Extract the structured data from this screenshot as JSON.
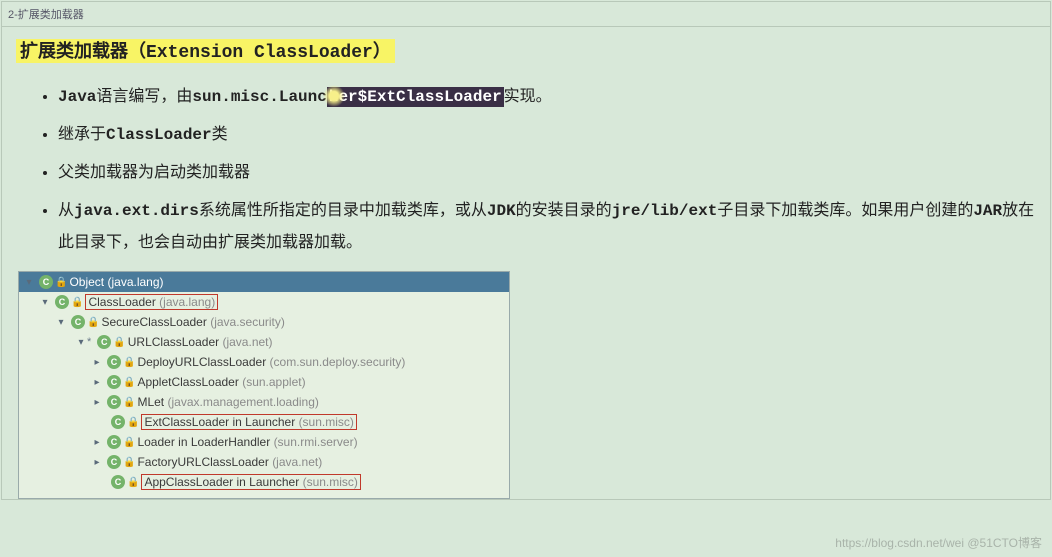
{
  "tab": {
    "title": "2-扩展类加载器"
  },
  "heading": {
    "prefix": "扩展类加载器（",
    "en": "Extension ClassLoader",
    "suffix": "）"
  },
  "bullets": {
    "b1_a": "Java",
    "b1_b": "语言编写，由",
    "b1_c": "sun.misc.Launc",
    "b1_sel": "her$ExtClassLoader",
    "b1_d": "实现。",
    "b2_a": "继承于",
    "b2_b": "ClassLoader",
    "b2_c": "类",
    "b3": "父类加载器为启动类加载器",
    "b4_a": "从",
    "b4_b": "java.ext.dirs",
    "b4_c": "系统属性所指定的目录中加载类库，或从",
    "b4_d": "JDK",
    "b4_e": "的安装目录的",
    "b4_f": "jre/lib/ext",
    "b4_g": "子目录下加载类库。如果用户创建的",
    "b4_h": "JAR",
    "b4_i": "放在此目录下，也会自动由扩展类加载器加载。"
  },
  "tree": {
    "root_name": "Object",
    "root_pkg": "(java.lang)",
    "n1_name": "ClassLoader",
    "n1_pkg": "(java.lang)",
    "n2_name": "SecureClassLoader",
    "n2_pkg": "(java.security)",
    "n3_name": "URLClassLoader",
    "n3_pkg": "(java.net)",
    "n4_name": "DeployURLClassLoader",
    "n4_pkg": "(com.sun.deploy.security)",
    "n5_name": "AppletClassLoader",
    "n5_pkg": "(sun.applet)",
    "n6_name": "MLet",
    "n6_pkg": "(javax.management.loading)",
    "n7_name": "ExtClassLoader in Launcher",
    "n7_pkg": "(sun.misc)",
    "n8_name": "Loader in LoaderHandler",
    "n8_pkg": "(sun.rmi.server)",
    "n9_name": "FactoryURLClassLoader",
    "n9_pkg": "(java.net)",
    "n10_name": "AppClassLoader in Launcher",
    "n10_pkg": "(sun.misc)"
  },
  "watermark": "https://blog.csdn.net/wei @51CTO博客"
}
